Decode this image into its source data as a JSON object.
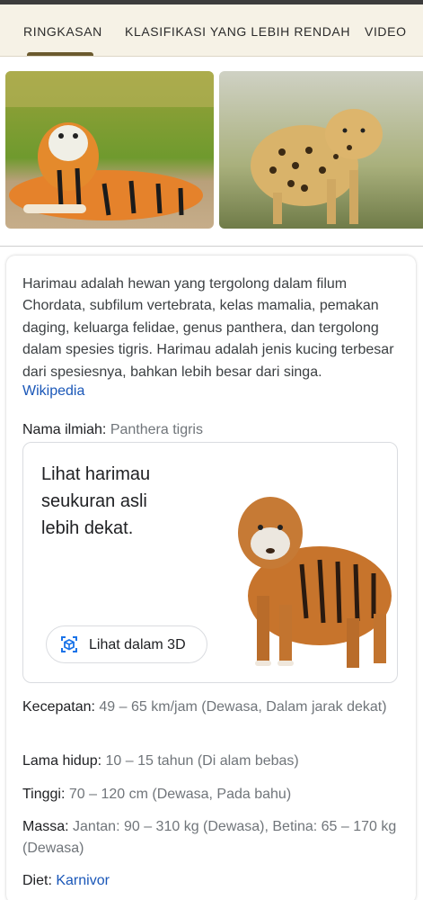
{
  "tabs": [
    {
      "label": "RINGKASAN",
      "active": true
    },
    {
      "label": "KLASIFIKASI YANG LEBIH RENDAH",
      "active": false
    },
    {
      "label": "VIDEO",
      "active": false
    }
  ],
  "images": [
    {
      "subject": "tiger-lying-on-grass"
    },
    {
      "subject": "leopard-walking"
    }
  ],
  "description": {
    "text": "Harimau adalah hewan yang tergolong dalam filum Chordata, subfilum vertebrata, kelas mamalia, pemakan daging, keluarga felidae, genus panthera, dan tergolong dalam spesies tigris. Harimau adalah jenis kucing terbesar dari spesiesnya, bahkan lebih besar dari singa.",
    "source": "Wikipedia"
  },
  "scientific_name": {
    "label": "Nama ilmiah:",
    "value": "Panthera tigris"
  },
  "view3d": {
    "prompt": "Lihat harimau seukuran asli lebih dekat.",
    "button_label": "Lihat dalam 3D"
  },
  "facts": [
    {
      "label": "Kecepatan:",
      "value": "49 – 65 km/jam (Dewasa, Dalam jarak dekat)"
    },
    {
      "label": "Lama hidup:",
      "value": "10 – 15 tahun (Di alam bebas)"
    },
    {
      "label": "Tinggi:",
      "value": "70 – 120 cm (Dewasa, Pada bahu)"
    },
    {
      "label": "Massa:",
      "value": "Jantan: 90 – 310 kg (Dewasa), Betina: 65 – 170 kg (Dewasa)"
    },
    {
      "label": "Diet:",
      "value": "Karnivor"
    }
  ],
  "colors": {
    "tab_bar_bg": "#f6f2e6",
    "tab_indicator": "#6b5a2e",
    "link": "#1a57b8",
    "muted_value": "#70757a"
  }
}
